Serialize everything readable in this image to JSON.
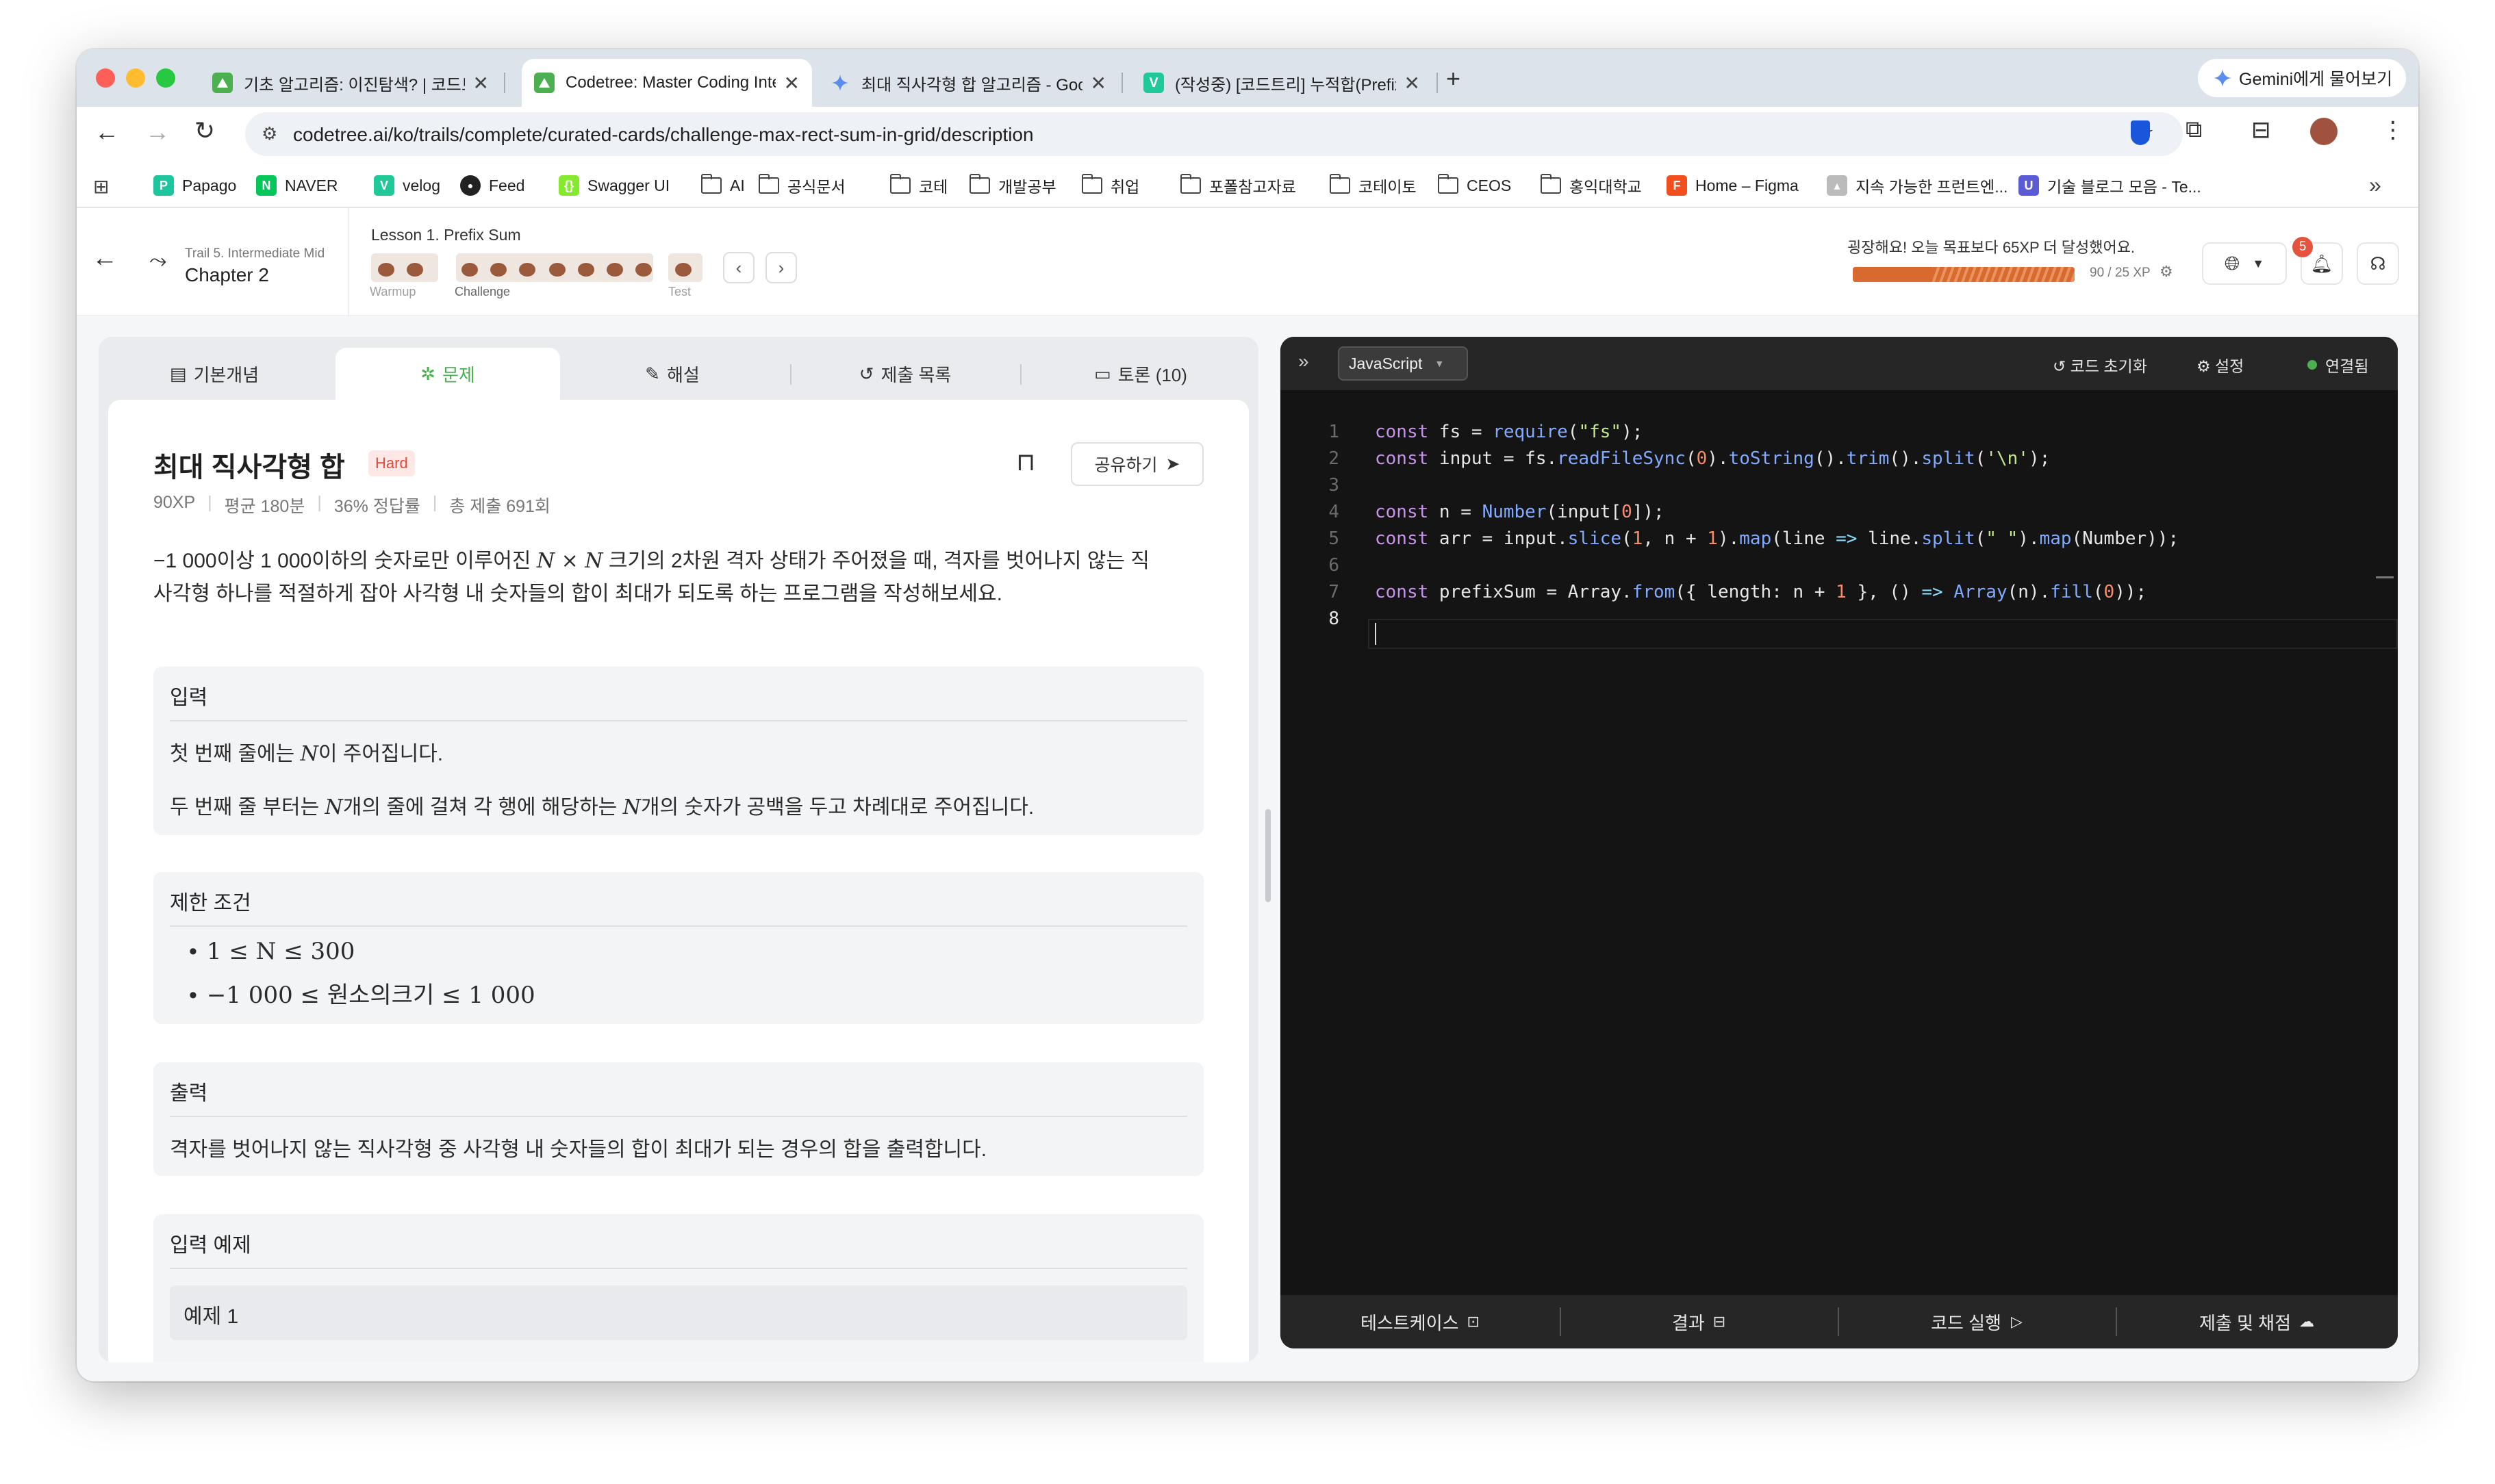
{
  "browser": {
    "tabs": [
      {
        "title": "기초 알고리즘: 이진탐색? | 코드트리",
        "favicon_color": "#4caf50",
        "favicon": "triangle-logo-icon"
      },
      {
        "title": "Codetree: Master Coding Interviews",
        "favicon_color": "#4caf50",
        "favicon": "triangle-logo-icon"
      },
      {
        "title": "최대 직사각형 합 알고리즘 - Google",
        "favicon_color": "#4285f4",
        "favicon": "gemini-icon"
      },
      {
        "title": "(작성중) [코드트리] 누적합(Prefix",
        "favicon_color": "#20c997",
        "favicon": "velog-icon"
      }
    ],
    "gemini_button": "Gemini에게 물어보기",
    "url": "codetree.ai/ko/trails/complete/curated-cards/challenge-max-rect-sum-in-grid/description",
    "bookmarks": [
      {
        "label": "Papago",
        "kind": "papago"
      },
      {
        "label": "NAVER",
        "kind": "naver"
      },
      {
        "label": "velog",
        "kind": "velog"
      },
      {
        "label": "Feed",
        "kind": "github"
      },
      {
        "label": "Swagger UI",
        "kind": "swagger"
      },
      {
        "label": "AI",
        "kind": "folder"
      },
      {
        "label": "공식문서",
        "kind": "folder"
      },
      {
        "label": "코테",
        "kind": "folder"
      },
      {
        "label": "개발공부",
        "kind": "folder"
      },
      {
        "label": "취업",
        "kind": "folder"
      },
      {
        "label": "포폴참고자료",
        "kind": "folder"
      },
      {
        "label": "코테이토",
        "kind": "folder"
      },
      {
        "label": "CEOS",
        "kind": "folder"
      },
      {
        "label": "홍익대학교",
        "kind": "folder"
      },
      {
        "label": "Home – Figma",
        "kind": "figma"
      },
      {
        "label": "지속 가능한 프런트엔...",
        "kind": "other"
      },
      {
        "label": "기술 블로그 모음 - Te...",
        "kind": "u"
      }
    ]
  },
  "header": {
    "trail": "Trail 5. Intermediate Mid",
    "chapter": "Chapter 2",
    "lesson": "Lesson 1. Prefix Sum",
    "stages": [
      "Warmup",
      "Challenge",
      "Test"
    ],
    "goal_message": "굉장해요! 오늘 목표보다 65XP 더 달성했어요.",
    "xp_text": "90 / 25 XP",
    "xp_progress": 1.0,
    "notification_count": "5"
  },
  "tabs": [
    {
      "label": "기본개념",
      "icon": "document-icon"
    },
    {
      "label": "문제",
      "icon": "puzzle-icon",
      "active": true
    },
    {
      "label": "해설",
      "icon": "edit-icon"
    },
    {
      "label": "제출 목록",
      "icon": "history-icon"
    },
    {
      "label": "토론 (10)",
      "icon": "chat-icon"
    }
  ],
  "problem": {
    "title": "최대 직사각형 합",
    "difficulty": "Hard",
    "share_label": "공유하기",
    "meta": [
      "90XP",
      "평균 180분",
      "36% 정답률",
      "총 제출 691회"
    ],
    "desc_line1_a": "−1 000이상 1 000이하의 숫자로만 이루어진 ",
    "desc_line1_math": "N × N",
    "desc_line1_b": " 크기의 2차원 격자 상태가 주어졌을 때, 격자를 벗어나지 않는 직",
    "desc_line2": "사각형 하나를 적절하게 잡아 사각형 내 숫자들의 합이 최대가 되도록 하는 프로그램을 작성해보세요.",
    "input_title": "입력",
    "input_line1_a": "첫 번째 줄에는 ",
    "input_line1_math": "N",
    "input_line1_b": "이 주어집니다.",
    "input_line2_a": "두 번째 줄 부터는 ",
    "input_line2_math": "N",
    "input_line2_b": "개의 줄에 걸쳐 각 행에 해당하는 ",
    "input_line2_math2": "N",
    "input_line2_c": "개의 숫자가 공백을 두고 차례대로 주어집니다.",
    "constraints_title": "제한 조건",
    "constraint1": "1 ≤ N ≤ 300",
    "constraint2": "−1 000 ≤ 원소의크기 ≤ 1 000",
    "output_title": "출력",
    "output_text": "격자를 벗어나지 않는 직사각형 중 사각형 내 숫자들의 합이 최대가 되는 경우의 합을 출력합니다.",
    "example_title": "입력 예제",
    "example1": "예제 1"
  },
  "editor": {
    "language": "JavaScript",
    "reset_label": "코드 초기화",
    "settings_label": "설정",
    "status_label": "연결됨",
    "status_color": "#4caf50",
    "line_numbers": [
      "1",
      "2",
      "3",
      "4",
      "5",
      "6",
      "7",
      "8"
    ],
    "active_line": "8",
    "bottom_buttons": [
      {
        "label": "테스트케이스",
        "icon": "testcase-icon"
      },
      {
        "label": "결과",
        "icon": "result-icon"
      },
      {
        "label": "코드 실행",
        "icon": "play-icon"
      },
      {
        "label": "제출 및 채점",
        "icon": "cloud-upload-icon"
      }
    ]
  },
  "code_lines": [
    "const fs = require(\"fs\");",
    "const input = fs.readFileSync(0).toString().trim().split('\\n');",
    "",
    "const n = Number(input[0]);",
    "const arr = input.slice(1, n + 1).map(line => line.split(\" \").map(Number));",
    "",
    "const prefixSum = Array.from({ length: n + 1 }, () => Array(n).fill(0));",
    ""
  ]
}
